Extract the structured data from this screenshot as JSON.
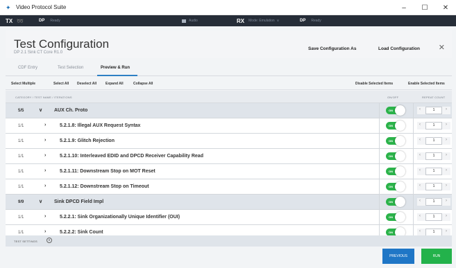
{
  "window": {
    "logo_glyph": "✦",
    "title": "Video Protocol Suite",
    "minimize": "–",
    "maximize": "☐",
    "close": "✕"
  },
  "toolbar": {
    "tx_label": "TX",
    "tx_indicator": "\u0001§",
    "tx_dp": "DP",
    "tx_mode": "Ready",
    "audio": "Audio",
    "rx_label": "RX",
    "rx_mode": "Mode: Emulation",
    "rx_dp": "DP",
    "rx_status": "Ready"
  },
  "header": {
    "title": "Test Configuration",
    "subtitle": "DP 2.1 Sink CT Core R1.0",
    "save_config": "Save Configuration As",
    "load_config": "Load Configuration",
    "close": "✕"
  },
  "tabs": [
    {
      "label": "CDF Entry"
    },
    {
      "label": "Test Selection"
    },
    {
      "label": "Preview & Run"
    }
  ],
  "actions": {
    "select_multiple": "Select Multiple",
    "select_all": "Select All",
    "deselect_all": "Deselect All",
    "expand_all": "Expand All",
    "collapse_all": "Collapse All",
    "disable_selected": "Disable Selected Items",
    "enable_selected": "Enable Selected Items"
  },
  "columns": {
    "name": "CATEGORY / TEST NAME / ITERATIONS",
    "onoff": "ON/OFF",
    "repeat": "REPEAT COUNT"
  },
  "rows": [
    {
      "count": "5/5",
      "chevron": "∨",
      "label": "AUX Ch. Proto",
      "on": "ON",
      "repeat": "1",
      "dec": "‹",
      "inc": "›"
    },
    {
      "count": "1/1",
      "chevron": "›",
      "label": "5.2.1.8: Illegal AUX Request Syntax",
      "on": "ON",
      "repeat": "1",
      "dec": "‹",
      "inc": "›"
    },
    {
      "count": "1/1",
      "chevron": "›",
      "label": "5.2.1.9: Glitch Rejection",
      "on": "ON",
      "repeat": "1",
      "dec": "‹",
      "inc": "›"
    },
    {
      "count": "1/1",
      "chevron": "›",
      "label": "5.2.1.10: Interleaved EDID and DPCD Receiver Capability Read",
      "on": "ON",
      "repeat": "1",
      "dec": "‹",
      "inc": "›"
    },
    {
      "count": "1/1",
      "chevron": "›",
      "label": "5.2.1.11: Downstream Stop on MOT Reset",
      "on": "ON",
      "repeat": "1",
      "dec": "‹",
      "inc": "›"
    },
    {
      "count": "1/1",
      "chevron": "›",
      "label": "5.2.1.12: Downstream Stop on Timeout",
      "on": "ON",
      "repeat": "1",
      "dec": "‹",
      "inc": "›"
    },
    {
      "count": "9/9",
      "chevron": "∨",
      "label": "Sink DPCD Field Impl",
      "on": "ON",
      "repeat": "1",
      "dec": "‹",
      "inc": "›"
    },
    {
      "count": "1/1",
      "chevron": "›",
      "label": "5.2.2.1: Sink Organizationally Unique Identifier (OUI)",
      "on": "ON",
      "repeat": "1",
      "dec": "‹",
      "inc": "›"
    },
    {
      "count": "1/1",
      "chevron": "›",
      "label": "5.2.2.2: Sink Count",
      "on": "ON",
      "repeat": "1",
      "dec": "‹",
      "inc": "›"
    }
  ],
  "settings": {
    "label": "TEST SETTINGS",
    "icon": "∨"
  },
  "footer": {
    "previous": "PREVIOUS",
    "run": "RUN"
  },
  "colors": {
    "accent": "#1f76c6",
    "toggle_on": "#2bb34a",
    "run": "#23b24b",
    "toolbar": "#262d38"
  }
}
